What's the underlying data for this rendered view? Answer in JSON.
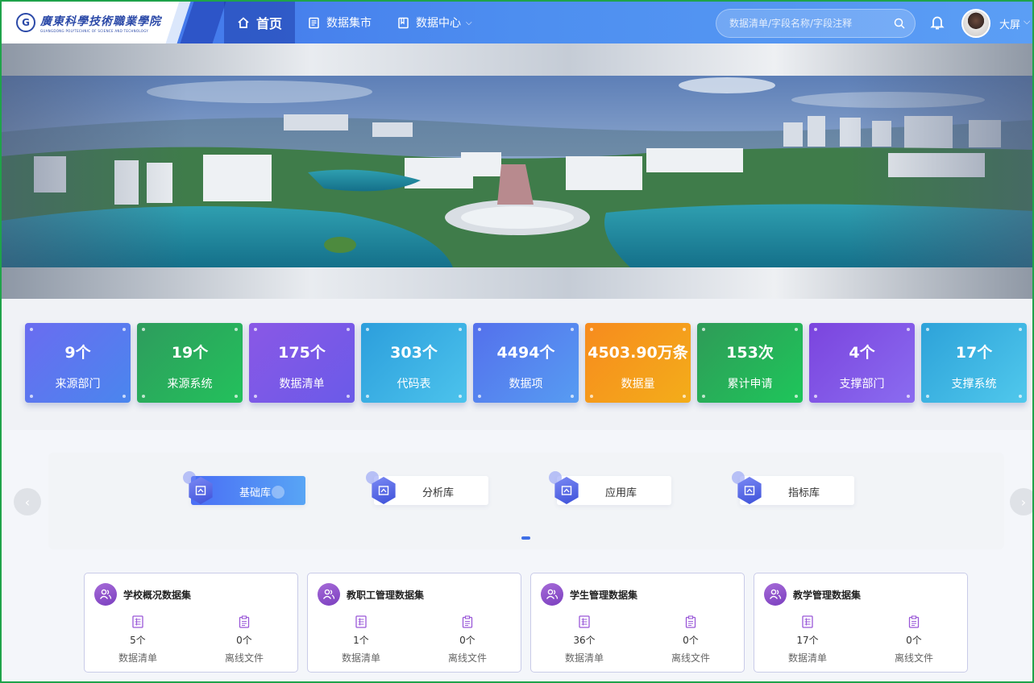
{
  "header": {
    "logo_text": "廣東科學技術職業學院",
    "logo_subtext": "GUANGDONG POLYTECHNIC OF SCIENCE AND TECHNOLOGY",
    "nav": [
      {
        "label": "首页",
        "icon": "home-icon",
        "active": true
      },
      {
        "label": "数据集市",
        "icon": "document-icon",
        "active": false
      },
      {
        "label": "数据中心",
        "icon": "book-icon",
        "active": false,
        "has_dropdown": true
      }
    ],
    "search_placeholder": "数据清单/字段名称/字段注释",
    "username": "大屏",
    "accent_color": "#4d8ef0"
  },
  "stats": [
    {
      "value": "9个",
      "label": "来源部门",
      "gradient": [
        "#6a6cf0",
        "#4a86ee"
      ]
    },
    {
      "value": "19个",
      "label": "来源系统",
      "gradient": [
        "#2e9c5d",
        "#23c15c"
      ]
    },
    {
      "value": "175个",
      "label": "数据清单",
      "gradient": [
        "#8a58e6",
        "#6a5ae8"
      ]
    },
    {
      "value": "303个",
      "label": "代码表",
      "gradient": [
        "#2c9edc",
        "#4cc3ec"
      ]
    },
    {
      "value": "4494个",
      "label": "数据项",
      "gradient": [
        "#5470ec",
        "#579cf2"
      ]
    },
    {
      "value": "4503.90万条",
      "label": "数据量",
      "gradient": [
        "#f78b1e",
        "#f3ad1a"
      ]
    },
    {
      "value": "153次",
      "label": "累计申请",
      "gradient": [
        "#2f9b58",
        "#1ec65a"
      ]
    },
    {
      "value": "4个",
      "label": "支撑部门",
      "gradient": [
        "#7b44de",
        "#8a6cf0"
      ]
    },
    {
      "value": "17个",
      "label": "支撑系统",
      "gradient": [
        "#2da2d9",
        "#50c8ec"
      ]
    }
  ],
  "tabs": [
    {
      "label": "基础库",
      "active": true
    },
    {
      "label": "分析库",
      "active": false
    },
    {
      "label": "应用库",
      "active": false
    },
    {
      "label": "指标库",
      "active": false
    }
  ],
  "datasets": [
    {
      "title": "学校概况数据集",
      "list_count": "5个",
      "list_label": "数据清单",
      "file_count": "0个",
      "file_label": "离线文件"
    },
    {
      "title": "教职工管理数据集",
      "list_count": "1个",
      "list_label": "数据清单",
      "file_count": "0个",
      "file_label": "离线文件"
    },
    {
      "title": "学生管理数据集",
      "list_count": "36个",
      "list_label": "数据清单",
      "file_count": "0个",
      "file_label": "离线文件"
    },
    {
      "title": "教学管理数据集",
      "list_count": "17个",
      "list_label": "数据清单",
      "file_count": "0个",
      "file_label": "离线文件"
    }
  ]
}
